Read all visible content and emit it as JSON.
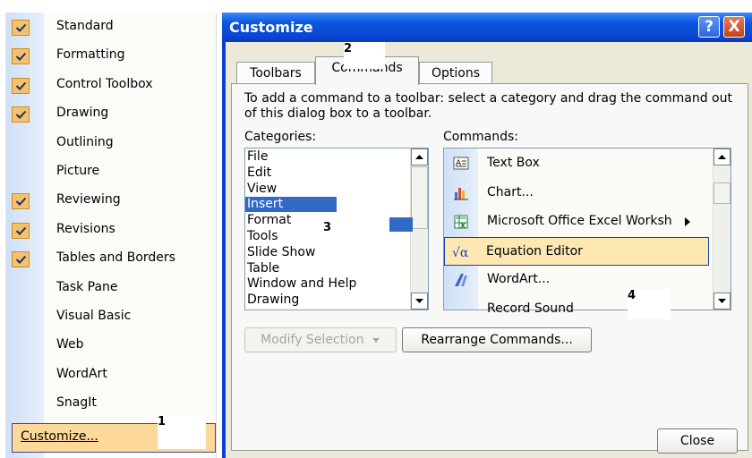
{
  "menu": {
    "items": [
      {
        "label": "Standard",
        "checked": true
      },
      {
        "label": "Formatting",
        "checked": true
      },
      {
        "label": "Control Toolbox",
        "checked": true
      },
      {
        "label": "Drawing",
        "checked": true
      },
      {
        "label": "Outlining",
        "checked": false
      },
      {
        "label": "Picture",
        "checked": false
      },
      {
        "label": "Reviewing",
        "checked": true
      },
      {
        "label": "Revisions",
        "checked": true
      },
      {
        "label": "Tables and Borders",
        "checked": true
      },
      {
        "label": "Task Pane",
        "checked": false
      },
      {
        "label": "Visual Basic",
        "checked": false
      },
      {
        "label": "Web",
        "checked": false
      },
      {
        "label": "WordArt",
        "checked": false
      },
      {
        "label": "SnagIt",
        "checked": false
      }
    ],
    "customize_label": "Customize..."
  },
  "annotations": {
    "n1": "1",
    "n2": "2",
    "n3": "3",
    "n4": "4"
  },
  "dialog": {
    "title": "Customize",
    "help_glyph": "?",
    "close_glyph": "X",
    "tabs": [
      {
        "label": "Toolbars",
        "selected": false
      },
      {
        "label": "Commands",
        "selected": true
      },
      {
        "label": "Options",
        "selected": false
      }
    ],
    "instructions": "To add a command to a toolbar: select a category and drag the command out of this dialog box to a toolbar.",
    "categories_label": "Categories:",
    "commands_label": "Commands:",
    "categories": [
      "File",
      "Edit",
      "View",
      "Insert",
      "Format",
      "Tools",
      "Slide Show",
      "Table",
      "Window and Help",
      "Drawing"
    ],
    "selected_category": "Insert",
    "commands": [
      {
        "label": "Text Box",
        "icon": "text-box-icon"
      },
      {
        "label": "Chart...",
        "icon": "chart-icon"
      },
      {
        "label": "Microsoft Office Excel Worksh",
        "icon": "excel-worksheet-icon"
      },
      {
        "label": "Equation Editor",
        "icon": "equation-icon"
      },
      {
        "label": "WordArt...",
        "icon": "wordart-icon"
      },
      {
        "label": "Record Sound",
        "icon": "record-sound-icon"
      }
    ],
    "selected_command": "Equation Editor",
    "modify_selection_label": "Modify Selection",
    "rearrange_label": "Rearrange Commands...",
    "close_label": "Close",
    "colors": {
      "title_bar": "#0a47d4",
      "selection": "#316ac5",
      "checkbox": "#f5c16c",
      "menu_highlight": "#fcd99a"
    }
  }
}
